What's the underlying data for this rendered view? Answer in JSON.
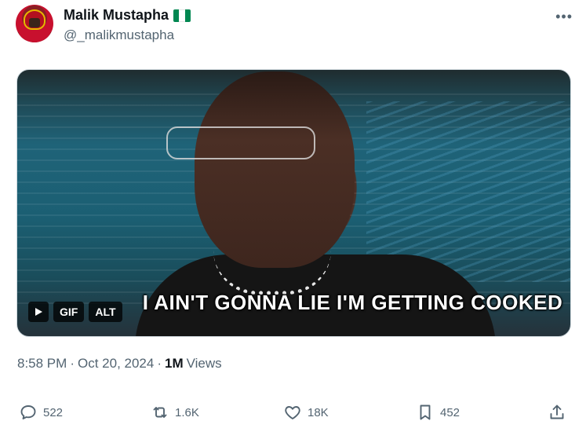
{
  "author": {
    "display_name": "Malik Mustapha",
    "handle": "@_malikmustapha",
    "flag_icon": "nigeria-flag-icon",
    "flag_colors": [
      "#008751",
      "#ffffff",
      "#008751"
    ]
  },
  "more_icon": "more-horizontal-icon",
  "media": {
    "caption": "I AIN'T GONNA LIE I'M GETTING COOKED",
    "gif_label": "GIF",
    "alt_label": "ALT",
    "play_icon": "play-icon"
  },
  "meta": {
    "time": "8:58 PM",
    "separator": "·",
    "date": "Oct 20, 2024",
    "views_count": "1M",
    "views_label": "Views"
  },
  "actions": {
    "replies": "522",
    "reposts": "1.6K",
    "likes": "18K",
    "bookmarks": "452",
    "reply_icon": "reply-icon",
    "repost_icon": "repost-icon",
    "like_icon": "heart-icon",
    "bookmark_icon": "bookmark-icon",
    "share_icon": "share-icon"
  },
  "colors": {
    "text_primary": "#0f1419",
    "text_secondary": "#536471",
    "border": "#cfd9de"
  }
}
